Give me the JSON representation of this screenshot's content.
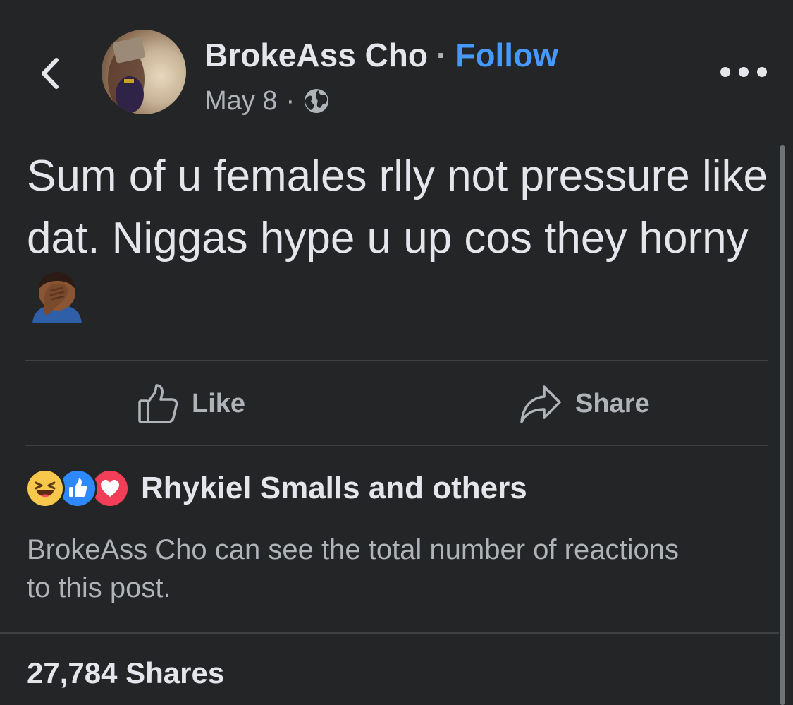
{
  "header": {
    "back_icon": "chevron-left-icon",
    "author_name": "BrokeAss Cho",
    "separator": "·",
    "follow_label": "Follow",
    "date": "May 8",
    "meta_separator": "·",
    "audience_icon": "globe-icon",
    "more_icon": "more-horizontal-icon"
  },
  "post": {
    "text": "Sum of u females rlly not pressure like dat. Niggas hype u up cos they horny",
    "trailing_emoji": "man-facepalming-icon"
  },
  "actions": {
    "like_label": "Like",
    "like_icon": "thumbs-up-outline-icon",
    "share_label": "Share",
    "share_icon": "share-arrow-icon"
  },
  "reactions": {
    "icons": [
      "haha-reaction-icon",
      "like-reaction-icon",
      "love-reaction-icon"
    ],
    "summary": "Rhykiel Smalls and others",
    "note": "BrokeAss Cho can see the total number of reactions to this post."
  },
  "shares": {
    "count_text": "27,784 Shares"
  },
  "colors": {
    "background": "#242526",
    "primary_text": "#e4e6eb",
    "secondary_text": "#b0b3b8",
    "link": "#4599ff",
    "divider": "#3e4042",
    "haha": "#f7c84b",
    "like": "#2e89ff",
    "love": "#f33e58"
  }
}
